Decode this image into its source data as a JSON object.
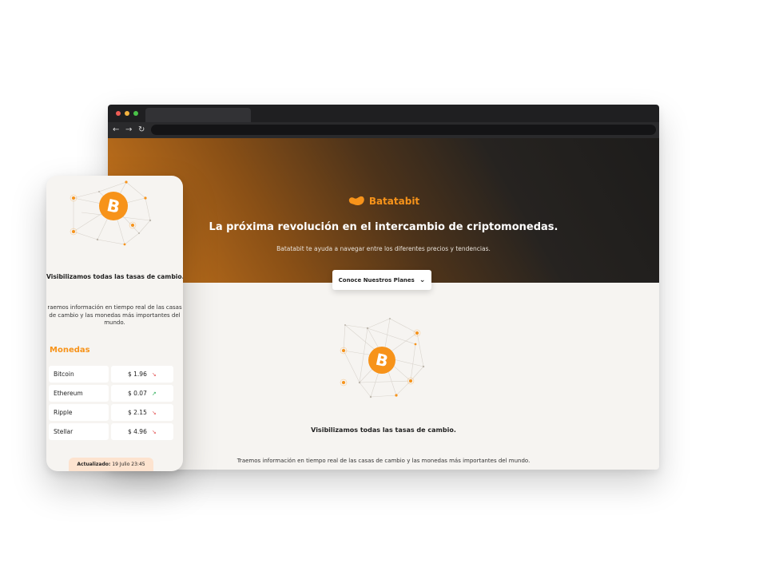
{
  "brand": {
    "name": "Batatabit",
    "accent": "#f7931a"
  },
  "hero": {
    "title": "La próxima revolución en el intercambio de criptomonedas.",
    "subtitle": "Batatabit te ayuda a navegar entre los diferentes precios y tendencias.",
    "cta_label": "Conoce Nuestros Planes"
  },
  "rates": {
    "headline": "Visibilizamos todas las tasas de cambio.",
    "paragraph": "Traemos información en tiempo real de las casas de cambio y las monedas más importantes del mundo.",
    "paragraph_mobile_lines": [
      "raemos información en tiempo real de las casas",
      "de cambio y las monedas más importantes del",
      "mundo."
    ]
  },
  "coins": {
    "title": "Monedas",
    "rows": [
      {
        "name": "Bitcoin",
        "price": "$ 1.96",
        "trend": "down"
      },
      {
        "name": "Ethereum",
        "price": "$ 0.07",
        "trend": "up"
      },
      {
        "name": "Ripple",
        "price": "$ 2.15",
        "trend": "down"
      },
      {
        "name": "Stellar",
        "price": "$ 4.96",
        "trend": "down"
      }
    ],
    "updated_label": "Actualizado:",
    "updated_value": "19 Julio 23:45"
  },
  "icons": {
    "coin": "bitcoin-icon",
    "logo": "batatabit-logo-icon",
    "trend_down": "trend-down-icon",
    "trend_up": "trend-up-icon"
  }
}
